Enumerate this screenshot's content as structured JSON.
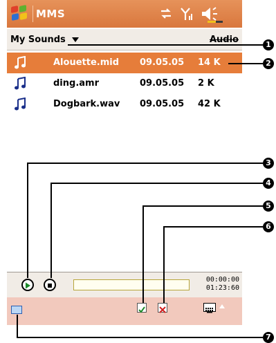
{
  "app": {
    "title": "MMS"
  },
  "header": {
    "folder": "My Sounds",
    "view": "Audio"
  },
  "files": [
    {
      "name": "Alouette.mid",
      "date": "09.05.05",
      "size": "14 K",
      "selected": true
    },
    {
      "name": "ding.amr",
      "date": "09.05.05",
      "size": "2 K",
      "selected": false
    },
    {
      "name": "Dogbark.wav",
      "date": "09.05.05",
      "size": "42 K",
      "selected": false
    }
  ],
  "player": {
    "elapsed": "00:00:00",
    "total": "01:23:60"
  },
  "callouts": [
    "1",
    "2",
    "3",
    "4",
    "5",
    "6",
    "7"
  ],
  "icons": {
    "start": "windows-flag-icon",
    "connectivity": "connectivity-icon",
    "signal": "signal-icon",
    "volume": "volume-icon",
    "note": "music-note-icon",
    "play": "play-icon",
    "stop": "stop-icon",
    "ok": "checkmark-icon",
    "cancel": "x-icon",
    "keyboard": "keyboard-icon",
    "sip": "input-panel-icon"
  },
  "colors": {
    "titlebar": "#d9773d",
    "selection": "#e67d3a",
    "menubar": "#f2c9bd"
  }
}
